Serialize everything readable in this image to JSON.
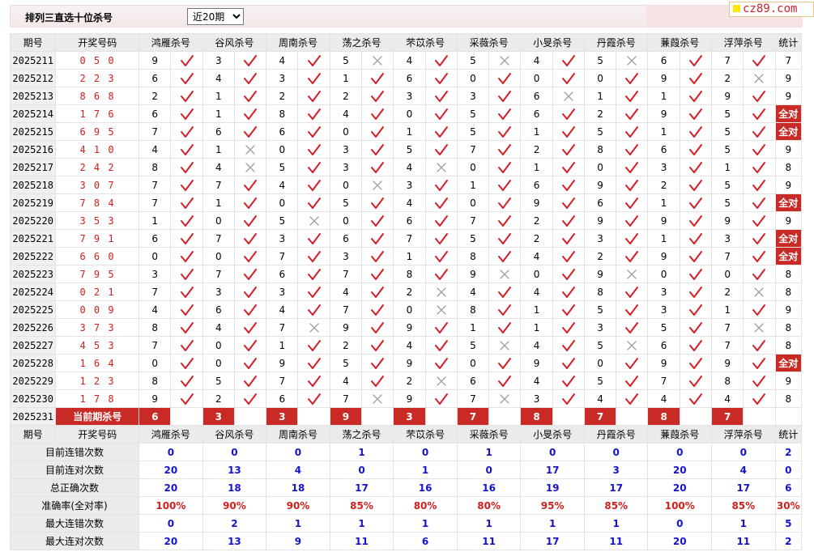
{
  "header": {
    "title": "排列三直选十位杀号",
    "select_value": "近20期",
    "select_options": [
      "近20期"
    ]
  },
  "logo": "cz89.com",
  "columns": {
    "period": "期号",
    "draw": "开奖号码",
    "stat": "统计",
    "experts": [
      "鸿雁杀号",
      "谷风杀号",
      "周南杀号",
      "荡之杀号",
      "芣苡杀号",
      "采薇杀号",
      "小旻杀号",
      "丹霞杀号",
      "蒹葭杀号",
      "浮萍杀号"
    ]
  },
  "rows": [
    {
      "period": "2025211",
      "draw": "0 5 0",
      "cells": [
        [
          "9",
          "y"
        ],
        [
          "3",
          "y"
        ],
        [
          "4",
          "y"
        ],
        [
          "5",
          "x"
        ],
        [
          "4",
          "y"
        ],
        [
          "5",
          "x"
        ],
        [
          "4",
          "y"
        ],
        [
          "5",
          "x"
        ],
        [
          "6",
          "y"
        ],
        [
          "7",
          "y"
        ]
      ],
      "stat": "7"
    },
    {
      "period": "2025212",
      "draw": "2 2 3",
      "cells": [
        [
          "6",
          "y"
        ],
        [
          "4",
          "y"
        ],
        [
          "3",
          "y"
        ],
        [
          "1",
          "y"
        ],
        [
          "6",
          "y"
        ],
        [
          "0",
          "y"
        ],
        [
          "0",
          "y"
        ],
        [
          "0",
          "y"
        ],
        [
          "9",
          "y"
        ],
        [
          "2",
          "x"
        ]
      ],
      "stat": "9"
    },
    {
      "period": "2025213",
      "draw": "8 6 8",
      "cells": [
        [
          "2",
          "y"
        ],
        [
          "1",
          "y"
        ],
        [
          "2",
          "y"
        ],
        [
          "2",
          "y"
        ],
        [
          "3",
          "y"
        ],
        [
          "3",
          "y"
        ],
        [
          "6",
          "x"
        ],
        [
          "1",
          "y"
        ],
        [
          "1",
          "y"
        ],
        [
          "9",
          "y"
        ]
      ],
      "stat": "9"
    },
    {
      "period": "2025214",
      "draw": "1 7 6",
      "cells": [
        [
          "6",
          "y"
        ],
        [
          "1",
          "y"
        ],
        [
          "8",
          "y"
        ],
        [
          "4",
          "y"
        ],
        [
          "0",
          "y"
        ],
        [
          "5",
          "y"
        ],
        [
          "6",
          "y"
        ],
        [
          "2",
          "y"
        ],
        [
          "9",
          "y"
        ],
        [
          "5",
          "y"
        ]
      ],
      "stat": "全对"
    },
    {
      "period": "2025215",
      "draw": "6 9 5",
      "cells": [
        [
          "7",
          "y"
        ],
        [
          "6",
          "y"
        ],
        [
          "6",
          "y"
        ],
        [
          "0",
          "y"
        ],
        [
          "1",
          "y"
        ],
        [
          "5",
          "y"
        ],
        [
          "1",
          "y"
        ],
        [
          "5",
          "y"
        ],
        [
          "1",
          "y"
        ],
        [
          "5",
          "y"
        ]
      ],
      "stat": "全对"
    },
    {
      "period": "2025216",
      "draw": "4 1 0",
      "cells": [
        [
          "4",
          "y"
        ],
        [
          "1",
          "x"
        ],
        [
          "0",
          "y"
        ],
        [
          "3",
          "y"
        ],
        [
          "5",
          "y"
        ],
        [
          "7",
          "y"
        ],
        [
          "2",
          "y"
        ],
        [
          "8",
          "y"
        ],
        [
          "6",
          "y"
        ],
        [
          "5",
          "y"
        ]
      ],
      "stat": "9"
    },
    {
      "period": "2025217",
      "draw": "2 4 2",
      "cells": [
        [
          "8",
          "y"
        ],
        [
          "4",
          "x"
        ],
        [
          "5",
          "y"
        ],
        [
          "3",
          "y"
        ],
        [
          "4",
          "x"
        ],
        [
          "0",
          "y"
        ],
        [
          "1",
          "y"
        ],
        [
          "0",
          "y"
        ],
        [
          "3",
          "y"
        ],
        [
          "1",
          "y"
        ]
      ],
      "stat": "8"
    },
    {
      "period": "2025218",
      "draw": "3 0 7",
      "cells": [
        [
          "7",
          "y"
        ],
        [
          "7",
          "y"
        ],
        [
          "4",
          "y"
        ],
        [
          "0",
          "x"
        ],
        [
          "3",
          "y"
        ],
        [
          "1",
          "y"
        ],
        [
          "6",
          "y"
        ],
        [
          "9",
          "y"
        ],
        [
          "2",
          "y"
        ],
        [
          "5",
          "y"
        ]
      ],
      "stat": "9"
    },
    {
      "period": "2025219",
      "draw": "7 8 4",
      "cells": [
        [
          "7",
          "y"
        ],
        [
          "1",
          "y"
        ],
        [
          "0",
          "y"
        ],
        [
          "5",
          "y"
        ],
        [
          "4",
          "y"
        ],
        [
          "0",
          "y"
        ],
        [
          "9",
          "y"
        ],
        [
          "6",
          "y"
        ],
        [
          "1",
          "y"
        ],
        [
          "5",
          "y"
        ]
      ],
      "stat": "全对"
    },
    {
      "period": "2025220",
      "draw": "3 5 3",
      "cells": [
        [
          "1",
          "y"
        ],
        [
          "0",
          "y"
        ],
        [
          "5",
          "x"
        ],
        [
          "0",
          "y"
        ],
        [
          "6",
          "y"
        ],
        [
          "7",
          "y"
        ],
        [
          "2",
          "y"
        ],
        [
          "9",
          "y"
        ],
        [
          "9",
          "y"
        ],
        [
          "9",
          "y"
        ]
      ],
      "stat": "9"
    },
    {
      "period": "2025221",
      "draw": "7 9 1",
      "cells": [
        [
          "6",
          "y"
        ],
        [
          "7",
          "y"
        ],
        [
          "3",
          "y"
        ],
        [
          "6",
          "y"
        ],
        [
          "7",
          "y"
        ],
        [
          "5",
          "y"
        ],
        [
          "2",
          "y"
        ],
        [
          "3",
          "y"
        ],
        [
          "1",
          "y"
        ],
        [
          "3",
          "y"
        ]
      ],
      "stat": "全对"
    },
    {
      "period": "2025222",
      "draw": "6 6 0",
      "cells": [
        [
          "0",
          "y"
        ],
        [
          "0",
          "y"
        ],
        [
          "7",
          "y"
        ],
        [
          "3",
          "y"
        ],
        [
          "1",
          "y"
        ],
        [
          "8",
          "y"
        ],
        [
          "4",
          "y"
        ],
        [
          "2",
          "y"
        ],
        [
          "9",
          "y"
        ],
        [
          "7",
          "y"
        ]
      ],
      "stat": "全对"
    },
    {
      "period": "2025223",
      "draw": "7 9 5",
      "cells": [
        [
          "3",
          "y"
        ],
        [
          "7",
          "y"
        ],
        [
          "6",
          "y"
        ],
        [
          "7",
          "y"
        ],
        [
          "8",
          "y"
        ],
        [
          "9",
          "x"
        ],
        [
          "0",
          "y"
        ],
        [
          "9",
          "x"
        ],
        [
          "0",
          "y"
        ],
        [
          "0",
          "y"
        ]
      ],
      "stat": "8"
    },
    {
      "period": "2025224",
      "draw": "0 2 1",
      "cells": [
        [
          "7",
          "y"
        ],
        [
          "3",
          "y"
        ],
        [
          "3",
          "y"
        ],
        [
          "4",
          "y"
        ],
        [
          "2",
          "x"
        ],
        [
          "4",
          "y"
        ],
        [
          "4",
          "y"
        ],
        [
          "8",
          "y"
        ],
        [
          "3",
          "y"
        ],
        [
          "2",
          "x"
        ]
      ],
      "stat": "8"
    },
    {
      "period": "2025225",
      "draw": "0 0 9",
      "cells": [
        [
          "4",
          "y"
        ],
        [
          "6",
          "y"
        ],
        [
          "4",
          "y"
        ],
        [
          "7",
          "y"
        ],
        [
          "0",
          "x"
        ],
        [
          "8",
          "y"
        ],
        [
          "1",
          "y"
        ],
        [
          "5",
          "y"
        ],
        [
          "3",
          "y"
        ],
        [
          "1",
          "y"
        ]
      ],
      "stat": "9"
    },
    {
      "period": "2025226",
      "draw": "3 7 3",
      "cells": [
        [
          "8",
          "y"
        ],
        [
          "4",
          "y"
        ],
        [
          "7",
          "x"
        ],
        [
          "9",
          "y"
        ],
        [
          "9",
          "y"
        ],
        [
          "1",
          "y"
        ],
        [
          "1",
          "y"
        ],
        [
          "3",
          "y"
        ],
        [
          "5",
          "y"
        ],
        [
          "7",
          "x"
        ]
      ],
      "stat": "8"
    },
    {
      "period": "2025227",
      "draw": "4 5 3",
      "cells": [
        [
          "7",
          "y"
        ],
        [
          "0",
          "y"
        ],
        [
          "1",
          "y"
        ],
        [
          "2",
          "y"
        ],
        [
          "4",
          "y"
        ],
        [
          "5",
          "x"
        ],
        [
          "4",
          "y"
        ],
        [
          "5",
          "x"
        ],
        [
          "6",
          "y"
        ],
        [
          "7",
          "y"
        ]
      ],
      "stat": "8"
    },
    {
      "period": "2025228",
      "draw": "1 6 4",
      "cells": [
        [
          "0",
          "y"
        ],
        [
          "0",
          "y"
        ],
        [
          "9",
          "y"
        ],
        [
          "5",
          "y"
        ],
        [
          "9",
          "y"
        ],
        [
          "0",
          "y"
        ],
        [
          "9",
          "y"
        ],
        [
          "0",
          "y"
        ],
        [
          "9",
          "y"
        ],
        [
          "9",
          "y"
        ]
      ],
      "stat": "全对"
    },
    {
      "period": "2025229",
      "draw": "1 2 3",
      "cells": [
        [
          "8",
          "y"
        ],
        [
          "5",
          "y"
        ],
        [
          "7",
          "y"
        ],
        [
          "4",
          "y"
        ],
        [
          "2",
          "x"
        ],
        [
          "6",
          "y"
        ],
        [
          "4",
          "y"
        ],
        [
          "5",
          "y"
        ],
        [
          "7",
          "y"
        ],
        [
          "8",
          "y"
        ]
      ],
      "stat": "9"
    },
    {
      "period": "2025230",
      "draw": "1 7 8",
      "cells": [
        [
          "9",
          "y"
        ],
        [
          "2",
          "y"
        ],
        [
          "6",
          "y"
        ],
        [
          "7",
          "x"
        ],
        [
          "9",
          "y"
        ],
        [
          "7",
          "x"
        ],
        [
          "3",
          "y"
        ],
        [
          "4",
          "y"
        ],
        [
          "4",
          "y"
        ],
        [
          "4",
          "y"
        ]
      ],
      "stat": "8"
    }
  ],
  "current": {
    "period": "2025231",
    "label": "当前期杀号",
    "values": [
      "6",
      "3",
      "3",
      "9",
      "3",
      "7",
      "8",
      "7",
      "8",
      "7"
    ]
  },
  "stats": [
    {
      "label": "目前连错次数",
      "values": [
        "0",
        "0",
        "0",
        "1",
        "0",
        "1",
        "0",
        "0",
        "0",
        "0"
      ],
      "total": "2",
      "red": false
    },
    {
      "label": "目前连对次数",
      "values": [
        "20",
        "13",
        "4",
        "0",
        "1",
        "0",
        "17",
        "3",
        "20",
        "4"
      ],
      "total": "0",
      "red": false
    },
    {
      "label": "总正确次数",
      "values": [
        "20",
        "18",
        "18",
        "17",
        "16",
        "16",
        "19",
        "17",
        "20",
        "17"
      ],
      "total": "6",
      "red": false
    },
    {
      "label": "准确率(全对率)",
      "values": [
        "100%",
        "90%",
        "90%",
        "85%",
        "80%",
        "80%",
        "95%",
        "85%",
        "100%",
        "85%"
      ],
      "total": "30%",
      "red": true
    },
    {
      "label": "最大连错次数",
      "values": [
        "0",
        "2",
        "1",
        "1",
        "1",
        "1",
        "1",
        "1",
        "0",
        "1"
      ],
      "total": "5",
      "red": false
    },
    {
      "label": "最大连对次数",
      "values": [
        "20",
        "13",
        "9",
        "11",
        "6",
        "11",
        "17",
        "11",
        "20",
        "11"
      ],
      "total": "2",
      "red": false
    }
  ],
  "colors": {
    "check": "#d51f26",
    "cross": "#a0a0a0",
    "accent": "#c92a26",
    "stat_blue": "#1414cc"
  }
}
